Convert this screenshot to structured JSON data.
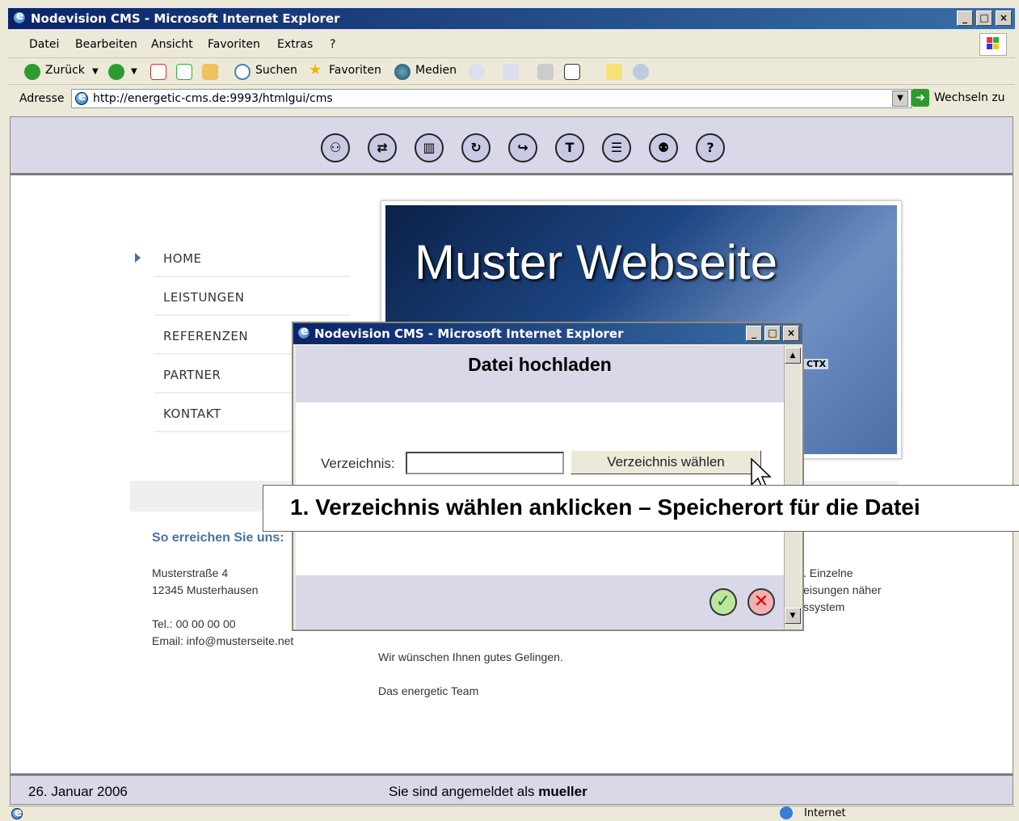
{
  "window": {
    "title": "Nodevision CMS - Microsoft Internet Explorer",
    "controls": [
      "_",
      "□",
      "×"
    ]
  },
  "menu": [
    "Datei",
    "Bearbeiten",
    "Ansicht",
    "Favoriten",
    "Extras",
    "?"
  ],
  "toolbar": {
    "back": "Zurück",
    "search": "Suchen",
    "favorites": "Favoriten",
    "media": "Medien"
  },
  "address": {
    "label": "Adresse",
    "url": "http://energetic-cms.de:9993/htmlgui/cms",
    "go": "Wechseln zu"
  },
  "cms_toolbar": {
    "icons": [
      "users-icon",
      "move-icon",
      "trash-icon",
      "refresh-icon",
      "forward-icon",
      "tools-icon",
      "document-list-icon",
      "user-group-icon",
      "help-icon"
    ],
    "help_glyph": "?"
  },
  "site": {
    "nav": [
      "HOME",
      "LEISTUNGEN",
      "REFERENZEN",
      "PARTNER",
      "KONTAKT"
    ],
    "banner_title": "Muster Webseite",
    "banner_badge": "CTX",
    "contact": {
      "title": "So erreichen Sie uns:",
      "street": "Musterstraße 4",
      "city": "12345 Musterhausen",
      "phone": "Tel.: 00 00 00 00",
      "email": "Email: info@musterseite.net"
    },
    "right_text": [
      ". Einzelne",
      "eisungen näher",
      "ssystem"
    ],
    "greeting": "Wir wünschen Ihnen gutes Gelingen.",
    "signature": "Das energetic Team",
    "status_date": "26. Januar 2006",
    "status_login_prefix": "Sie sind angemeldet als",
    "status_user": "mueller"
  },
  "popup": {
    "title": "Nodevision CMS - Microsoft Internet Explorer",
    "heading": "Datei hochladen",
    "dir_label": "Verzeichnis:",
    "dir_value": "",
    "dir_button": "Verzeichnis wählen",
    "ok_glyph": "✓",
    "cancel_glyph": "✕"
  },
  "callout": "1. Verzeichnis wählen anklicken – Speicherort für die Datei",
  "ie_status": {
    "zone": "Internet"
  }
}
